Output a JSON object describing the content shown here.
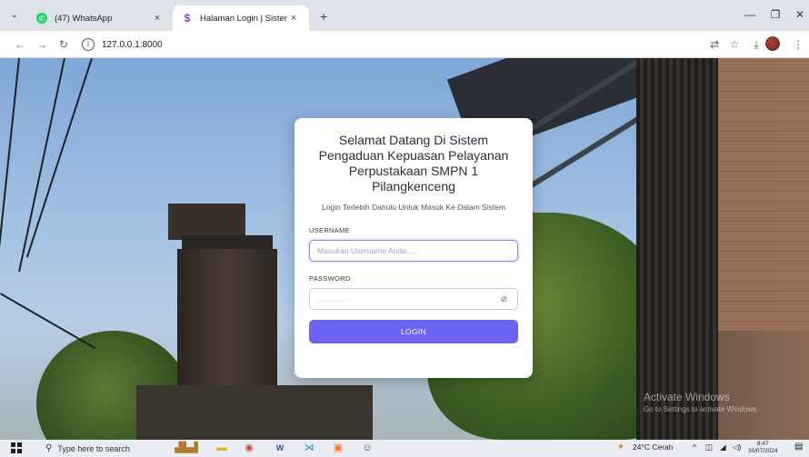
{
  "browser": {
    "tabs": [
      {
        "title": "(47) WhatsApp",
        "active": false
      },
      {
        "title": "Halaman Login | Sistem Pengad",
        "active": true
      }
    ],
    "url": "127.0.0.1:8000",
    "close_glyph": "×",
    "new_tab_glyph": "+"
  },
  "login": {
    "title": "Selamat Datang Di Sistem Pengaduan Kepuasan Pelayanan Perpustakaan SMPN 1 Pilangkenceng",
    "subtitle": "Login Terlebih Dahulu Untuk Masuk Ke Dalam Sistem",
    "username_label": "USERNAME",
    "username_placeholder": "Masukan Username Anda......",
    "password_label": "PASSWORD",
    "password_value": "...........",
    "button_label": "LOGIN",
    "accent_color": "#6c63f0"
  },
  "watermark": {
    "line1": "Activate Windows",
    "line2": "Go to Settings to activate Windows."
  },
  "taskbar": {
    "search_placeholder": "Type here to search",
    "weather": "24°C  Cerah",
    "time": "8:47",
    "date": "30/07/2024"
  }
}
